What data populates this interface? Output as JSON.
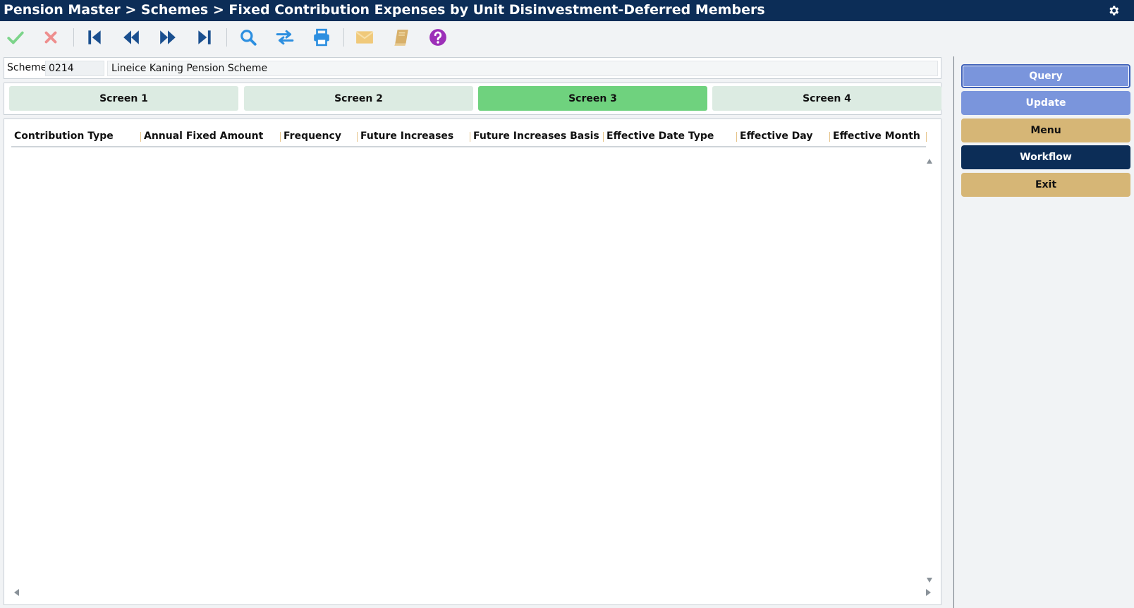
{
  "header": {
    "title": "Pension Master > Schemes > Fixed Contribution Expenses by Unit Disinvestment-Deferred Members"
  },
  "toolbar": {
    "buttons": [
      {
        "name": "accept",
        "icon": "check-icon",
        "color": "#7cd48a"
      },
      {
        "name": "cancel",
        "icon": "close-icon",
        "color": "#ee8e8e"
      },
      {
        "name": "first",
        "icon": "first-record-icon",
        "color": "#1a4f8f"
      },
      {
        "name": "previous",
        "icon": "previous-record-icon",
        "color": "#1a4f8f"
      },
      {
        "name": "next",
        "icon": "next-record-icon",
        "color": "#1a4f8f"
      },
      {
        "name": "last",
        "icon": "last-record-icon",
        "color": "#1a4f8f"
      },
      {
        "name": "search",
        "icon": "search-icon",
        "color": "#2d8fe0"
      },
      {
        "name": "swap",
        "icon": "swap-icon",
        "color": "#2d8fe0"
      },
      {
        "name": "print",
        "icon": "print-icon",
        "color": "#2d8fe0"
      },
      {
        "name": "mail",
        "icon": "mail-icon",
        "color": "#f0c97a"
      },
      {
        "name": "notes",
        "icon": "book-icon",
        "color": "#d8b06a"
      },
      {
        "name": "help",
        "icon": "help-icon",
        "color": "#9c2fb8"
      }
    ]
  },
  "scheme": {
    "label": "Scheme",
    "code": "0214",
    "name": "Lineice Kaning Pension Scheme"
  },
  "tabs": [
    {
      "label": "Screen 1",
      "active": false
    },
    {
      "label": "Screen 2",
      "active": false
    },
    {
      "label": "Screen 3",
      "active": true
    },
    {
      "label": "Screen 4",
      "active": false
    }
  ],
  "grid": {
    "columns": [
      "Contribution Type",
      "Annual Fixed Amount",
      "Frequency",
      "Future Increases",
      "Future Increases Basis",
      "Effective Date Type",
      "Effective Day",
      "Effective Month"
    ],
    "rows": []
  },
  "side_buttons": {
    "query": "Query",
    "update": "Update",
    "menu": "Menu",
    "workflow": "Workflow",
    "exit": "Exit"
  },
  "colors": {
    "titlebar": "#0c2d57",
    "active_tab": "#6fd27e",
    "inactive_tab": "#dcebe2",
    "query_update": "#7a95dc",
    "menu_exit": "#d6b676",
    "workflow": "#0c2d57"
  }
}
